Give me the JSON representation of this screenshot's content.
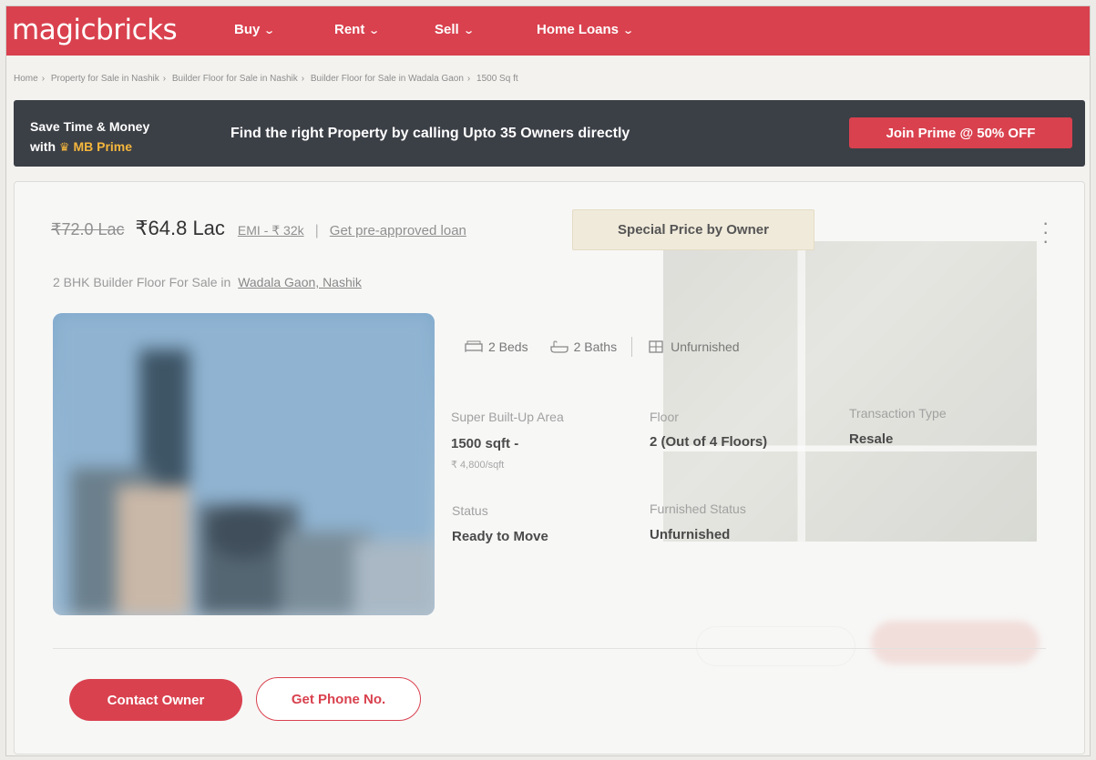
{
  "nav": {
    "logo": "magicbricks",
    "items": [
      {
        "label": "Buy"
      },
      {
        "label": "Rent"
      },
      {
        "label": "Sell"
      },
      {
        "label": "Home Loans"
      }
    ]
  },
  "breadcrumb": [
    "Home",
    "Property for Sale in Nashik",
    "Builder Floor for Sale in Nashik",
    "Builder Floor for Sale in Wadala Gaon",
    "1500 Sq ft"
  ],
  "prime": {
    "left_line1": "Save Time & Money",
    "left_with": "with",
    "left_brand": "MB Prime",
    "message": "Find the right Property by calling Upto 35 Owners directly",
    "cta": "Join Prime @ 50% OFF"
  },
  "listing": {
    "old_price": "₹72.0 Lac",
    "price": "₹64.8 Lac",
    "emi": "EMI - ₹ 32k",
    "separator": "|",
    "loan_link": "Get pre-approved loan",
    "special_badge": "Special Price by Owner",
    "subtitle": "2 BHK Builder Floor For Sale in",
    "locality": "Wadala Gaon, Nashik",
    "amenities": {
      "beds": "2 Beds",
      "baths": "2 Baths",
      "furnishing": "Unfurnished"
    },
    "details": {
      "area_label": "Super Built-Up Area",
      "area_value": "1500 sqft -",
      "area_rate": "₹ 4,800/sqft",
      "floor_label": "Floor",
      "floor_value": "2 (Out of 4 Floors)",
      "transaction_label": "Transaction Type",
      "transaction_value": "Resale",
      "status_label": "Status",
      "status_value": "Ready to Move",
      "furnished_label": "Furnished Status",
      "furnished_value": "Unfurnished"
    },
    "actions": {
      "contact": "Contact Owner",
      "phone": "Get Phone No."
    }
  },
  "colors": {
    "brand": "#d9414e",
    "banner": "#3b3f46",
    "prime_gold": "#f5b73c"
  }
}
